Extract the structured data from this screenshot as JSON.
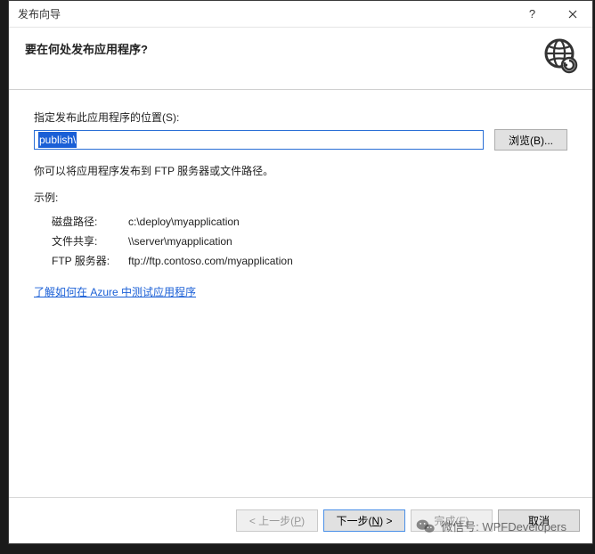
{
  "titlebar": {
    "title": "发布向导",
    "help": "?",
    "close": "×"
  },
  "header": {
    "question": "要在何处发布应用程序?"
  },
  "content": {
    "location_label": "指定发布此应用程序的位置(S):",
    "path_value": "publish\\",
    "browse_label": "浏览(B)...",
    "desc": "你可以将应用程序发布到 FTP 服务器或文件路径。",
    "example_label": "示例:",
    "examples": {
      "disk_label": "磁盘路径:",
      "disk_value": "c:\\deploy\\myapplication",
      "share_label": "文件共享:",
      "share_value": "\\\\server\\myapplication",
      "ftp_label": "FTP 服务器:",
      "ftp_value": "ftp://ftp.contoso.com/myapplication"
    },
    "azure_link": "了解如何在 Azure 中测试应用程序"
  },
  "footer": {
    "prev": "< 上一步(P)",
    "next": "下一步(N) >",
    "finish": "完成(F)",
    "cancel": "取消"
  },
  "watermark": {
    "text": "微信号: WPFDevelopers"
  }
}
